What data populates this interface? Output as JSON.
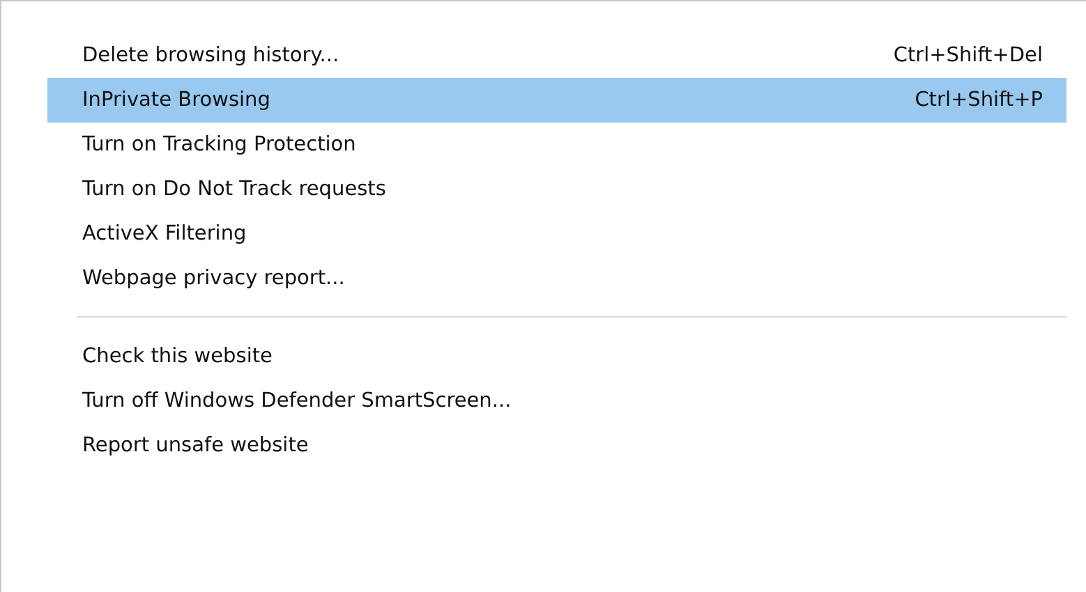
{
  "menu": {
    "groups": [
      {
        "items": [
          {
            "label": "Delete browsing history...",
            "shortcut": "Ctrl+Shift+Del",
            "selected": false
          },
          {
            "label": "InPrivate Browsing",
            "shortcut": "Ctrl+Shift+P",
            "selected": true
          },
          {
            "label": "Turn on Tracking Protection",
            "selected": false
          },
          {
            "label": "Turn on Do Not Track requests",
            "selected": false
          },
          {
            "label": "ActiveX Filtering",
            "selected": false
          },
          {
            "label": "Webpage privacy report...",
            "selected": false
          }
        ]
      },
      {
        "items": [
          {
            "label": "Check this website",
            "selected": false
          },
          {
            "label": "Turn off Windows Defender SmartScreen...",
            "selected": false
          },
          {
            "label": "Report unsafe website",
            "selected": false
          }
        ]
      }
    ]
  }
}
